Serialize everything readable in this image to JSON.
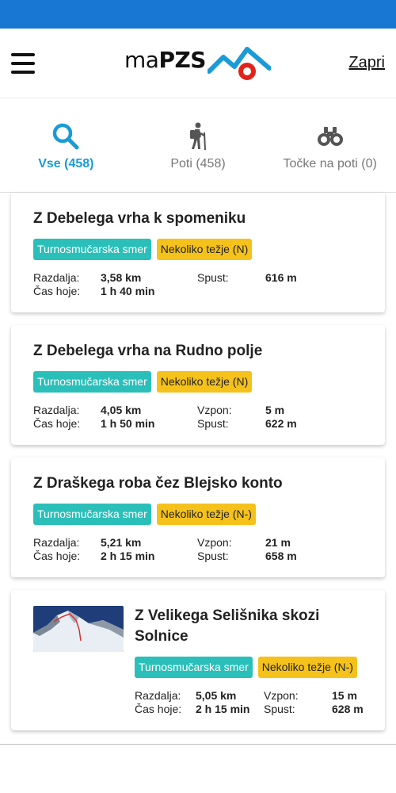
{
  "header": {
    "logo_prefix": "ma",
    "logo_brand": "PZS",
    "close_label": "Zapri"
  },
  "tabs": [
    {
      "label": "Vse (458)",
      "icon": "search-icon",
      "active": true
    },
    {
      "label": "Poti (458)",
      "icon": "hiker-icon",
      "active": false
    },
    {
      "label": "Točke na poti (0)",
      "icon": "binoculars-icon",
      "active": false
    }
  ],
  "routes": [
    {
      "title": "Z Debelega vrha k spomeniku",
      "type": "Turnosmučarska smer",
      "difficulty": "Nekoliko težje (N)",
      "stats": [
        {
          "label": "Razdalja:",
          "value": "3,58 km",
          "label2": "Spust:",
          "value2": "616 m"
        },
        {
          "label": "Čas hoje:",
          "value": "1 h 40 min",
          "label2": "",
          "value2": ""
        }
      ]
    },
    {
      "title": "Z Debelega vrha na Rudno polje",
      "type": "Turnosmučarska smer",
      "difficulty": "Nekoliko težje (N)",
      "stats": [
        {
          "label": "Razdalja:",
          "value": "4,05 km",
          "label2": "Vzpon:",
          "value2": "5 m"
        },
        {
          "label": "Čas hoje:",
          "value": "1 h 50 min",
          "label2": "Spust:",
          "value2": "622 m"
        }
      ]
    },
    {
      "title": "Z Draškega roba čez Blejsko konto",
      "type": "Turnosmučarska smer",
      "difficulty": "Nekoliko težje (N-)",
      "stats": [
        {
          "label": "Razdalja:",
          "value": "5,21 km",
          "label2": "Vzpon:",
          "value2": "21 m"
        },
        {
          "label": "Čas hoje:",
          "value": "2 h 15 min",
          "label2": "Spust:",
          "value2": "658 m"
        }
      ]
    },
    {
      "title": "Z Velikega Selišnika skozi Solnice",
      "type": "Turnosmučarska smer",
      "difficulty": "Nekoliko težje (N-)",
      "stats": [
        {
          "label": "Razdalja:",
          "value": "5,05 km",
          "label2": "Vzpon:",
          "value2": "15 m"
        },
        {
          "label": "Čas hoje:",
          "value": "2 h 15 min",
          "label2": "Spust:",
          "value2": "628 m"
        }
      ]
    }
  ],
  "colors": {
    "status_bar": "#1877d2",
    "accent": "#1a9bd6",
    "type_badge": "#2bbfb9",
    "difficulty_badge": "#f5c21b",
    "logo_red": "#e2231a"
  }
}
